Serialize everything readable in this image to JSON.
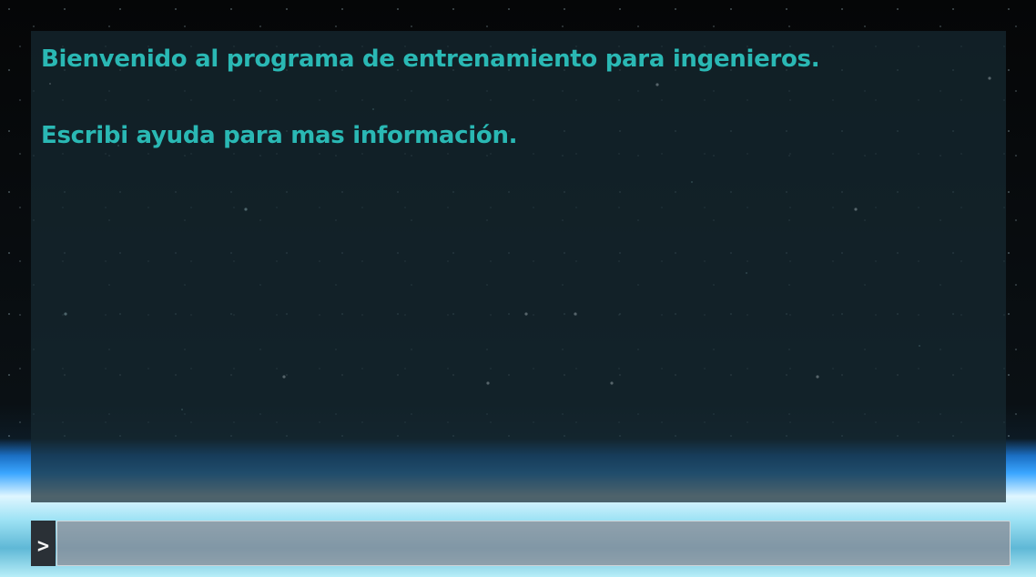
{
  "console": {
    "lines": [
      "Bienvenido al programa de entrenamiento para ingenieros.",
      "Escribi ayuda para mas información."
    ],
    "text_color": "#2ab8b4"
  },
  "input": {
    "prompt": ">",
    "value": ""
  }
}
